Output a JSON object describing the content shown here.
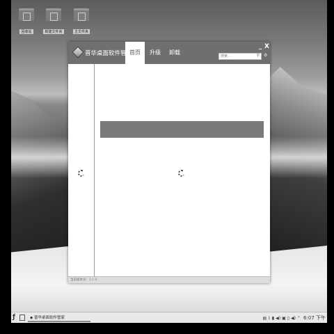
{
  "desktop": {
    "icons": [
      {
        "label": "回收站",
        "icon": "trash-icon"
      },
      {
        "label": "新建文件夹",
        "icon": "folder-icon"
      },
      {
        "label": "主文件夹",
        "icon": "home-folder-icon"
      }
    ]
  },
  "window": {
    "app_title": "普华桌面软件管家",
    "tabs": [
      {
        "label": "首页",
        "active": true
      },
      {
        "label": "升级",
        "active": false
      },
      {
        "label": "卸载",
        "active": false
      }
    ],
    "minimize_label": "_",
    "close_label": "X",
    "search": {
      "placeholder": "搜索...",
      "icon": "search-icon"
    },
    "status_text": "当前版本号：1.1.6"
  },
  "taskbar": {
    "task_title": "普华桌面软件管家",
    "clock": "6:07 下午",
    "tray_icons": [
      "clipboard-icon",
      "bluetooth-icon",
      "battery-icon",
      "volume-icon",
      "network-icon",
      "volume-icon",
      "arrow-up-icon"
    ]
  },
  "colors": {
    "titlebar": "#6f6f6f",
    "banner": "#7a7a7a",
    "taskbar": "#e8e8e8"
  }
}
